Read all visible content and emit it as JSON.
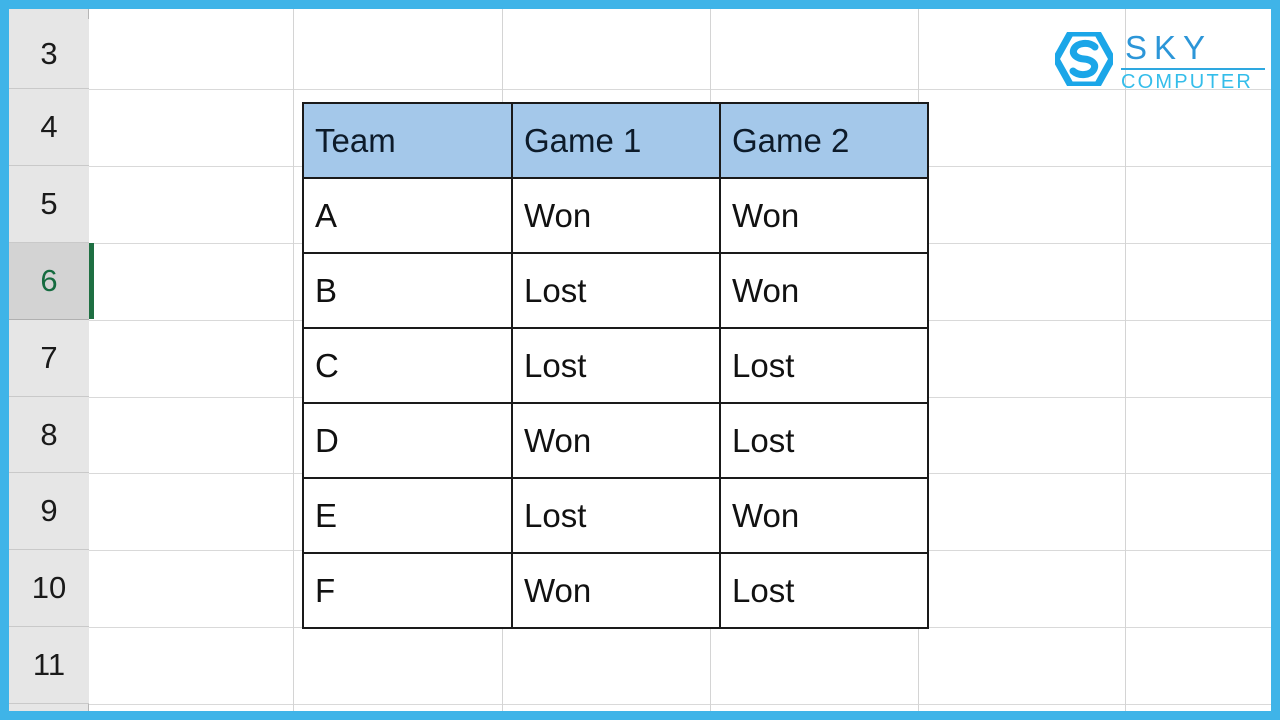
{
  "app": {
    "type": "spreadsheet",
    "frame_color": "#3FB4E8",
    "background": "#FFFFFF"
  },
  "grid": {
    "row_headers": [
      {
        "label": "3",
        "selected": false
      },
      {
        "label": "4",
        "selected": false
      },
      {
        "label": "5",
        "selected": false
      },
      {
        "label": "6",
        "selected": true
      },
      {
        "label": "7",
        "selected": false
      },
      {
        "label": "8",
        "selected": false
      },
      {
        "label": "9",
        "selected": false
      },
      {
        "label": "10",
        "selected": false
      },
      {
        "label": "11",
        "selected": false
      }
    ],
    "selected_row_accent": "#1E6F42",
    "row_header_bg": "#E6E6E6",
    "row_header_selected_bg": "#D3D3D3",
    "gridline_color": "#D9D9D9"
  },
  "table": {
    "header_bg": "#A4C8EA",
    "border_color": "#1A1A1A",
    "headers": [
      "Team",
      "Game 1",
      "Game 2"
    ],
    "rows": [
      {
        "team": "A",
        "game1": "Won",
        "game2": "Won"
      },
      {
        "team": "B",
        "game1": "Lost",
        "game2": "Won"
      },
      {
        "team": "C",
        "game1": "Lost",
        "game2": "Lost"
      },
      {
        "team": "D",
        "game1": "Won",
        "game2": "Lost"
      },
      {
        "team": "E",
        "game1": "Lost",
        "game2": "Won"
      },
      {
        "team": "F",
        "game1": "Won",
        "game2": "Lost"
      }
    ]
  },
  "logo": {
    "mark_icon": "hexagon-s-icon",
    "primary_text": "SKY",
    "secondary_text": "COMPUTER",
    "primary_color": "#2C96D8",
    "secondary_color": "#34BDEA",
    "mark_color": "#1BA6E8"
  }
}
